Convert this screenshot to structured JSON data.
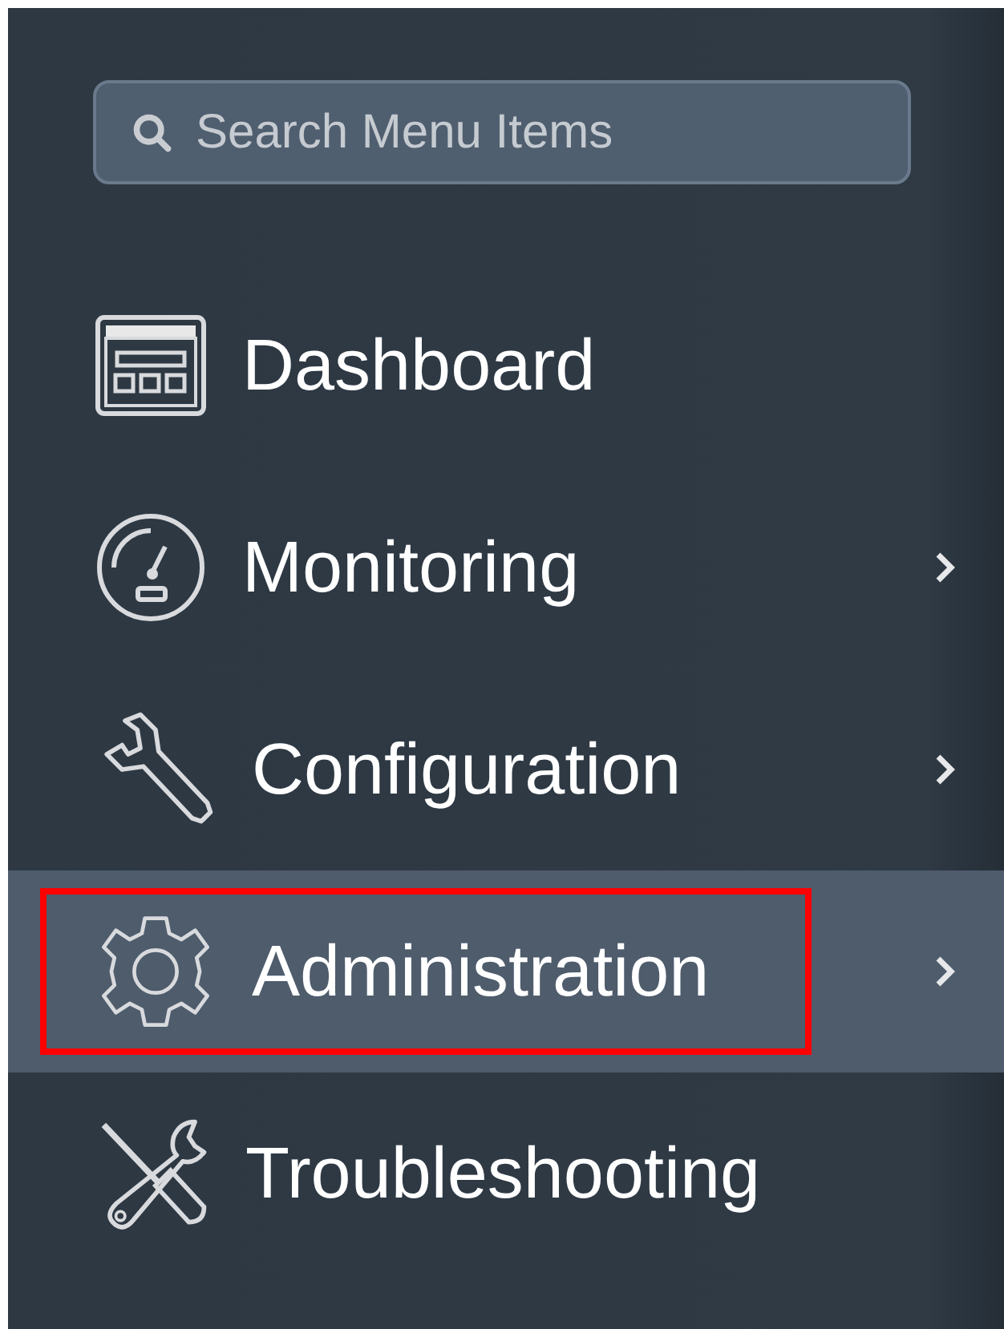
{
  "search": {
    "placeholder": "Search Menu Items"
  },
  "menu": [
    {
      "kind": "dashboard",
      "label": "Dashboard",
      "submenu": false,
      "selected": false,
      "outlined": false
    },
    {
      "kind": "gauge",
      "label": "Monitoring",
      "submenu": true,
      "selected": false,
      "outlined": false
    },
    {
      "kind": "wrench",
      "label": "Configuration",
      "submenu": true,
      "selected": false,
      "outlined": false
    },
    {
      "kind": "gear",
      "label": "Administration",
      "submenu": true,
      "selected": true,
      "outlined": true
    },
    {
      "kind": "tools",
      "label": "Troubleshooting",
      "submenu": false,
      "selected": false,
      "outlined": false
    }
  ]
}
